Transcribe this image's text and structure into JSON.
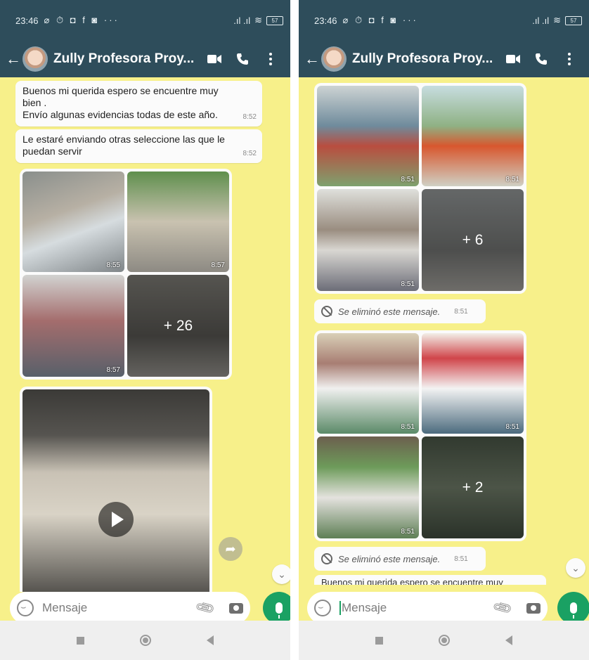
{
  "status_bar": {
    "time": "23:46",
    "notification_icons": "⌀ ⏱ ◘ f ◙ ···",
    "signal": ".ıl .ıl",
    "battery": "57"
  },
  "chat_header": {
    "contact_name": "Zully Profesora Proy..."
  },
  "left_screen": {
    "messages": [
      {
        "text": "Buenos mi querida espero se encuentre muy bien .\nEnvío algunas evidencias todas de este año.",
        "time": "8:52"
      },
      {
        "text": "Le estaré enviando otras seleccione las que le puedan servir",
        "time": "8:52"
      }
    ],
    "photo_grid": {
      "times": [
        "8:55",
        "8:57",
        "8:57"
      ],
      "more_count": "+ 26"
    }
  },
  "right_screen": {
    "photo_grid_1": {
      "times": [
        "8:51",
        "8:51",
        "8:51"
      ],
      "more_count": "+ 6"
    },
    "deleted_1": {
      "text": "Se eliminó este mensaje.",
      "time": "8:51"
    },
    "photo_grid_2": {
      "times": [
        "8:51",
        "8:51",
        "8:51"
      ],
      "more_count": "+ 2"
    },
    "deleted_2": {
      "text": "Se eliminó este mensaje.",
      "time": "8:51"
    },
    "partial_message": "Buenos mi querida espero se encuentre muy"
  },
  "composer": {
    "placeholder": "Mensaje"
  },
  "icons": {
    "back": "back-arrow-icon",
    "video_call": "video-call-icon",
    "voice_call": "phone-icon",
    "menu": "kebab-menu-icon",
    "emoji": "emoji-icon",
    "attach": "paperclip-icon",
    "camera": "camera-icon",
    "mic": "microphone-icon"
  },
  "colors": {
    "header": "#2e4d5b",
    "chat_background": "#f7f08a",
    "accent_green": "#1aa163"
  }
}
